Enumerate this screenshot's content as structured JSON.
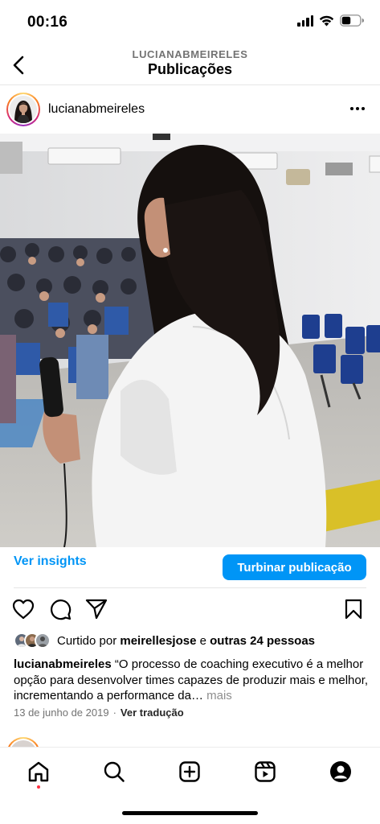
{
  "status_bar": {
    "time": "00:16",
    "icons": [
      "cellular-signal-icon",
      "wifi-icon",
      "battery-icon"
    ]
  },
  "header": {
    "subtitle": "LUCIANABMEIRELES",
    "title": "Publicações"
  },
  "post": {
    "username": "lucianabmeireles",
    "insights_label": "Ver insights",
    "boost_label": "Turbinar publicação",
    "likes": {
      "prefix": "Curtido por ",
      "liked_by": "meirellesjose",
      "connector": " e ",
      "others": "outras 24 pessoas"
    },
    "caption": {
      "username": "lucianabmeireles",
      "text": " “O processo de coaching executivo é a melhor opção para desenvolver times capazes de produzir mais e melhor, incrementando a performance da… ",
      "more": "mais"
    },
    "date": "13 de junho de 2019",
    "separator": "·",
    "translate_label": "Ver tradução"
  },
  "tab_bar": {
    "items": [
      "home-icon",
      "search-icon",
      "create-icon",
      "reels-icon",
      "profile-icon"
    ],
    "active": "home-icon"
  },
  "colors": {
    "accent": "#0095f6",
    "notification": "#ff3040",
    "text": "#262626",
    "muted": "#737373"
  }
}
